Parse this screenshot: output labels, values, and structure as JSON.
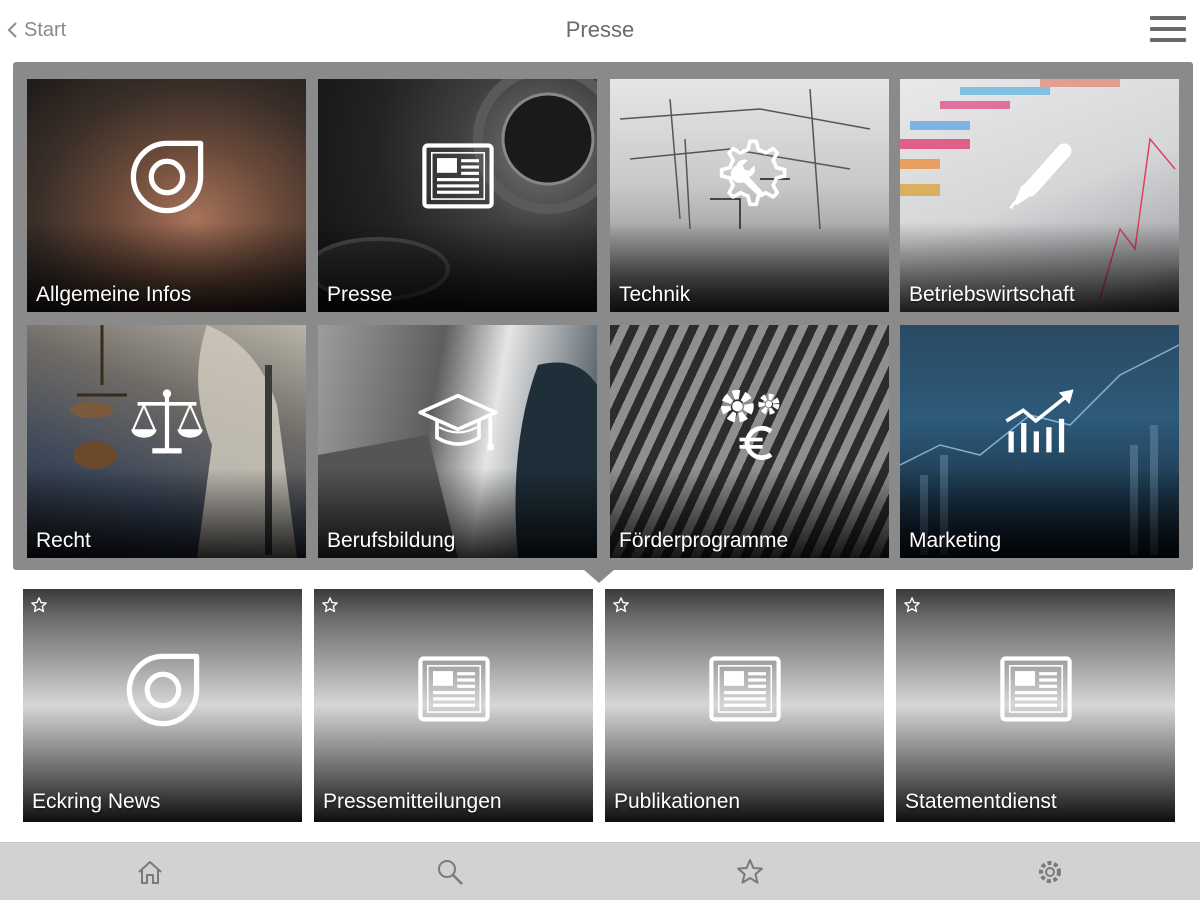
{
  "header": {
    "back_label": "Start",
    "title": "Presse"
  },
  "categories": [
    {
      "label": "Allgemeine Infos",
      "icon": "eckring-logo-icon"
    },
    {
      "label": "Presse",
      "icon": "newspaper-icon"
    },
    {
      "label": "Technik",
      "icon": "gear-wrench-icon"
    },
    {
      "label": "Betriebswirtschaft",
      "icon": "pen-icon"
    },
    {
      "label": "Recht",
      "icon": "scales-icon"
    },
    {
      "label": "Berufsbildung",
      "icon": "graduation-cap-icon"
    },
    {
      "label": "Förderprogramme",
      "icon": "gears-euro-icon"
    },
    {
      "label": "Marketing",
      "icon": "growth-chart-icon"
    }
  ],
  "tiles": [
    {
      "label": "Eckring News",
      "icon": "eckring-logo-icon",
      "favorite_icon": "star-outline-icon"
    },
    {
      "label": "Pressemitteilungen",
      "icon": "newspaper-icon",
      "favorite_icon": "star-outline-icon"
    },
    {
      "label": "Publikationen",
      "icon": "newspaper-icon",
      "favorite_icon": "star-outline-icon"
    },
    {
      "label": "Statementdienst",
      "icon": "newspaper-icon",
      "favorite_icon": "star-outline-icon"
    }
  ],
  "tabbar": {
    "items": [
      "home-icon",
      "search-icon",
      "star-icon",
      "settings-icon"
    ]
  },
  "colors": {
    "panel": "#8a8a8a",
    "tabbar": "#d2d2d2",
    "label_text": "#ffffff",
    "icon_gray": "#7a7a7a"
  }
}
